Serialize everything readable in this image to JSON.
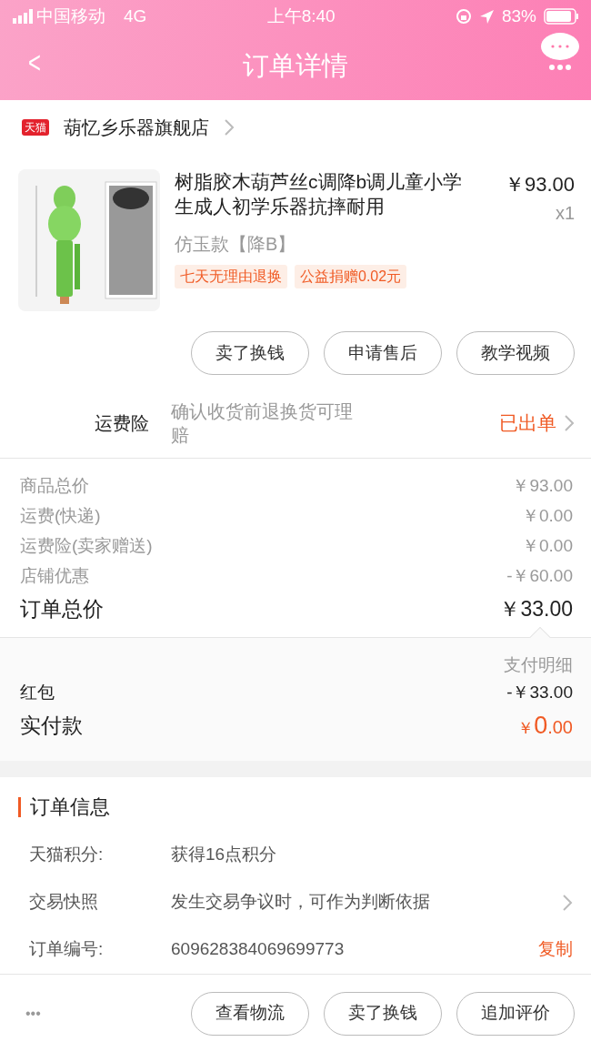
{
  "status_bar": {
    "carrier": "中国移动",
    "network": "4G",
    "time": "上午8:40",
    "battery": "83%"
  },
  "nav": {
    "back": "<",
    "title": "订单详情"
  },
  "shop": {
    "badge": "天猫",
    "name": "葫忆乡乐器旗舰店"
  },
  "product": {
    "image": {
      "kind": "picture"
    },
    "title": "树脂胶木葫芦丝c调降b调儿童小学生成人初学乐器抗摔耐用",
    "price": "￥93.00",
    "quantity": "x1",
    "variant": "仿玉款【降B】",
    "tags": [
      "七天无理由退换",
      "公益捐赠0.02元"
    ]
  },
  "item_actions": [
    "卖了换钱",
    "申请售后",
    "教学视频"
  ],
  "insurance": {
    "label": "运费险",
    "description": "确认收货前退换货可理赔",
    "status": "已出单"
  },
  "costs": [
    {
      "label": "商品总价",
      "value": "￥93.00",
      "kind": "minor"
    },
    {
      "label": "运费(快递)",
      "value": "￥0.00",
      "kind": "minor"
    },
    {
      "label": "运费险(卖家赠送)",
      "value": "￥0.00",
      "kind": "minor"
    },
    {
      "label": "店铺优惠",
      "value": "-￥60.00",
      "kind": "minor"
    },
    {
      "label": "订单总价",
      "value": "￥33.00",
      "kind": "total"
    }
  ],
  "payment": {
    "link": "支付明细",
    "rows": [
      {
        "label": "红包",
        "value": "-￥33.00",
        "kind": "minor"
      },
      {
        "label": "实付款",
        "value_symbol": "￥",
        "value_main": "0",
        "value_cents": ".00",
        "kind": "paid"
      }
    ]
  },
  "order_info": {
    "title": "订单信息",
    "rows": [
      {
        "label": "天猫积分:",
        "value": "获得16点积分",
        "has_arrow": false
      },
      {
        "label": "交易快照",
        "value": "发生交易争议时，可作为判断依据",
        "has_arrow": true
      },
      {
        "label": "订单编号:",
        "value": "609628384069699773",
        "action": "复制",
        "has_arrow": false
      }
    ]
  },
  "bottom_bar": {
    "more": "•••",
    "buttons": [
      "查看物流",
      "卖了换钱",
      "追加评价"
    ]
  }
}
